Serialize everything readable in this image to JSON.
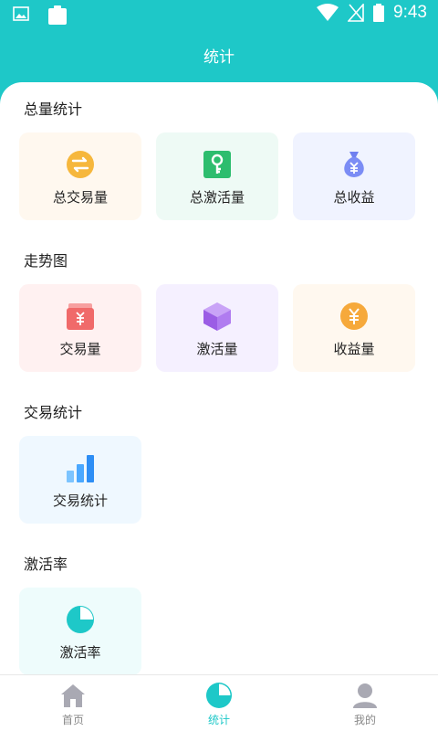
{
  "status_bar": {
    "time": "9:43",
    "icons": [
      "image-icon",
      "clipboard-icon",
      "wifi-icon",
      "no-signal-icon",
      "battery-icon"
    ]
  },
  "header": {
    "title": "统计"
  },
  "sections": [
    {
      "title": "总量统计",
      "cards": [
        {
          "label": "总交易量",
          "icon": "exchange-icon",
          "bg": "#fff8ef"
        },
        {
          "label": "总激活量",
          "icon": "key-icon",
          "bg": "#eefaf5"
        },
        {
          "label": "总收益",
          "icon": "money-bag-icon",
          "bg": "#f0f3ff"
        }
      ]
    },
    {
      "title": "走势图",
      "cards": [
        {
          "label": "交易量",
          "icon": "wallet-icon",
          "bg": "#fff1f1"
        },
        {
          "label": "激活量",
          "icon": "box-icon",
          "bg": "#f5f0ff"
        },
        {
          "label": "收益量",
          "icon": "yen-coin-icon",
          "bg": "#fff8ef"
        }
      ]
    },
    {
      "title": "交易统计",
      "cards": [
        {
          "label": "交易统计",
          "icon": "bar-chart-icon",
          "bg": "#eff8ff"
        }
      ]
    },
    {
      "title": "激活率",
      "cards": [
        {
          "label": "激活率",
          "icon": "pie-chart-icon",
          "bg": "#eefcfc"
        }
      ]
    }
  ],
  "bottom_nav": [
    {
      "label": "首页",
      "icon": "home-icon",
      "active": false
    },
    {
      "label": "统计",
      "icon": "pie-chart-icon",
      "active": true
    },
    {
      "label": "我的",
      "icon": "user-icon",
      "active": false
    }
  ],
  "colors": {
    "primary": "#1ec8c8",
    "text": "#222222",
    "inactive": "#888888"
  }
}
